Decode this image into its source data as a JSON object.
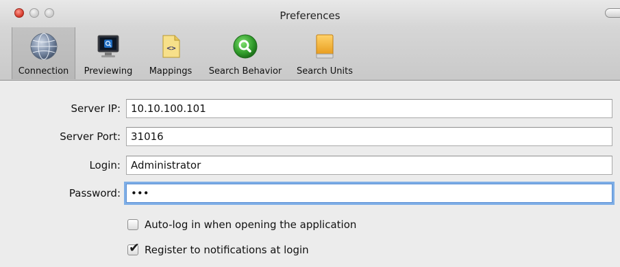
{
  "window": {
    "title": "Preferences"
  },
  "toolbar": {
    "items": [
      {
        "label": "Connection",
        "icon": "globe-icon",
        "selected": true
      },
      {
        "label": "Previewing",
        "icon": "monitor-icon",
        "selected": false
      },
      {
        "label": "Mappings",
        "icon": "document-code-icon",
        "selected": false
      },
      {
        "label": "Search Behavior",
        "icon": "search-icon",
        "selected": false
      },
      {
        "label": "Search Units",
        "icon": "drive-icon",
        "selected": false
      }
    ]
  },
  "form": {
    "server_ip": {
      "label": "Server IP:",
      "value": "10.10.100.101"
    },
    "server_port": {
      "label": "Server Port:",
      "value": "31016"
    },
    "login": {
      "label": "Login:",
      "value": "Administrator"
    },
    "password": {
      "label": "Password:",
      "value": "•••"
    },
    "auto_login": {
      "label": "Auto-log in when opening the application",
      "checked": false
    },
    "register_notifications": {
      "label": "Register to notifications at login",
      "checked": true,
      "mark": "✔"
    }
  },
  "colors": {
    "focus_ring": "#7eaee6",
    "close_button": "#d63a2c",
    "search_icon": "#2f9a2a",
    "drive_icon": "#f2b233"
  }
}
